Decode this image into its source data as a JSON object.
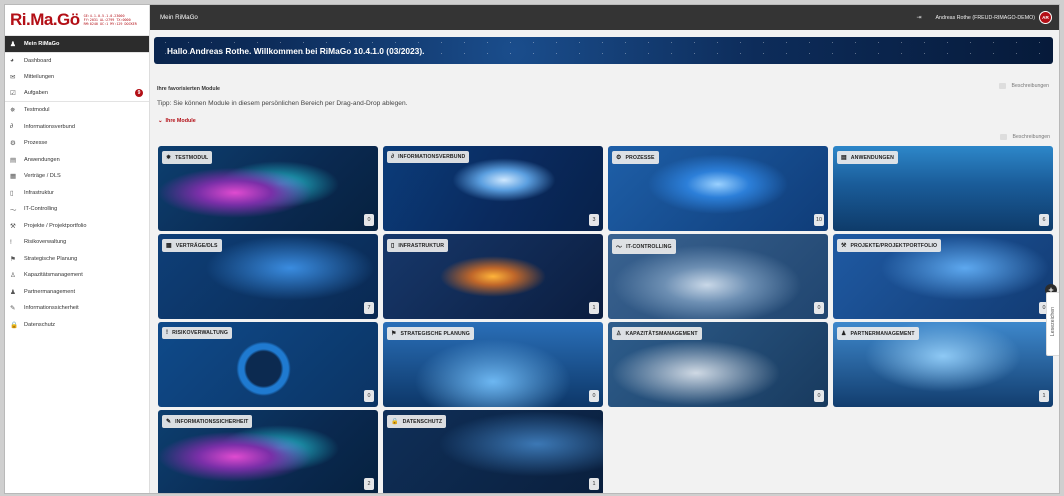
{
  "app": {
    "logo": "Ri.Ma.Gö",
    "logo_meta": [
      "GE:4.1.0-5.1.0.23000",
      "FY:2031 AL:2799 TX:0000",
      "RM:0240 OC:1 MY:129 DOCKER"
    ],
    "title": "Mein RiMaGo"
  },
  "topbar": {
    "icon": "logout-icon",
    "user": "Andreas Rothe (FREUD-RIMAGO-DEMO)",
    "avatar": "AR"
  },
  "sidebar": {
    "items": [
      {
        "label": "Mein RiMaGo",
        "icon": "user-icon",
        "glyph": "♟"
      },
      {
        "label": "Dashboard",
        "icon": "dashboard-icon",
        "glyph": "◕"
      },
      {
        "label": "Mitteilungen",
        "icon": "mail-icon",
        "glyph": "✉"
      },
      {
        "label": "Aufgaben",
        "icon": "tasks-icon",
        "glyph": "☑",
        "badge": "9"
      },
      {
        "label": "Testmodul",
        "icon": "testmodul-icon",
        "glyph": "✵"
      },
      {
        "label": "Informationsverbund",
        "icon": "link-icon",
        "glyph": "∂"
      },
      {
        "label": "Prozesse",
        "icon": "gears-icon",
        "glyph": "⚙"
      },
      {
        "label": "Anwendungen",
        "icon": "window-icon",
        "glyph": "▤"
      },
      {
        "label": "Verträge / DLS",
        "icon": "contract-icon",
        "glyph": "▦"
      },
      {
        "label": "Infrastruktur",
        "icon": "server-icon",
        "glyph": "▯"
      },
      {
        "label": "IT-Controlling",
        "icon": "chart-line-icon",
        "glyph": "〜"
      },
      {
        "label": "Projekte / Projektportfolio",
        "icon": "project-icon",
        "glyph": "⚒"
      },
      {
        "label": "Risikoverwaltung",
        "icon": "exclamation-icon",
        "glyph": "!"
      },
      {
        "label": "Strategische Planung",
        "icon": "flag-icon",
        "glyph": "⚑"
      },
      {
        "label": "Kapazitätsmanagement",
        "icon": "person-icon",
        "glyph": "♙"
      },
      {
        "label": "Partnermanagement",
        "icon": "users-icon",
        "glyph": "♟"
      },
      {
        "label": "Informationssicherheit",
        "icon": "pen-icon",
        "glyph": "✎"
      },
      {
        "label": "Datenschutz",
        "icon": "lock-icon",
        "glyph": "🔒"
      }
    ]
  },
  "main": {
    "banner": "Hallo Andreas Rothe. Willkommen bei RiMaGo 10.4.1.0 (03/2023).",
    "favorites_title": "Ihre favorisierten Module",
    "descriptions_label": "Beschreibungen",
    "tip": "Tipp: Sie können Module in diesem persönlichen Bereich per Drag-and-Drop ablegen.",
    "modules_toggle": "Ihre Module",
    "modules_descriptions_label": "Beschreibungen"
  },
  "tiles": [
    {
      "label": "TESTMODUL",
      "icon": "testmodul-icon",
      "glyph": "✵",
      "count": "0",
      "theme": "paint"
    },
    {
      "label": "INFORMATIONSVERBUND",
      "icon": "link-icon",
      "glyph": "∂",
      "count": "3",
      "theme": "dna"
    },
    {
      "label": "PROZESSE",
      "icon": "gears-icon",
      "glyph": "⚙",
      "count": "10",
      "theme": "chip"
    },
    {
      "label": "ANWENDUNGEN",
      "icon": "window-icon",
      "glyph": "▤",
      "count": "6",
      "theme": "city"
    },
    {
      "label": "VERTRÄGE/DLS",
      "icon": "contract-icon",
      "glyph": "▦",
      "count": "7",
      "theme": "circuit"
    },
    {
      "label": "INFRASTRUKTUR",
      "icon": "server-icon",
      "glyph": "▯",
      "count": "1",
      "theme": "highway"
    },
    {
      "label": "IT-CONTROLLING",
      "icon": "chart-line-icon",
      "glyph": "〜",
      "count": "0",
      "theme": "office"
    },
    {
      "label": "PROJEKTE/PROJEKTPORTFOLIO",
      "icon": "project-icon",
      "glyph": "⚒",
      "count": "0",
      "theme": "charts"
    },
    {
      "label": "RISIKOVERWALTUNG",
      "icon": "exclamation-icon",
      "glyph": "!",
      "count": "0",
      "theme": "magnifier"
    },
    {
      "label": "STRATEGISCHE PLANUNG",
      "icon": "flag-icon",
      "glyph": "⚑",
      "count": "0",
      "theme": "chess"
    },
    {
      "label": "KAPAZITÄTSMANAGEMENT",
      "icon": "person-icon",
      "glyph": "♙",
      "count": "0",
      "theme": "desk"
    },
    {
      "label": "PARTNERMANAGEMENT",
      "icon": "users-icon",
      "glyph": "♟",
      "count": "1",
      "theme": "people"
    },
    {
      "label": "INFORMATIONSSICHERHEIT",
      "icon": "pen-icon",
      "glyph": "✎",
      "count": "2",
      "theme": "paint"
    },
    {
      "label": "DATENSCHUTZ",
      "icon": "lock-icon",
      "glyph": "🔒",
      "count": "1",
      "theme": "security"
    }
  ],
  "side_panel": {
    "label": "Lesezeichen",
    "plus_icon": "plus-circle-icon"
  },
  "colors": {
    "brand": "#b30f16",
    "topbar": "#343434",
    "banner": "#0d2c5a"
  }
}
